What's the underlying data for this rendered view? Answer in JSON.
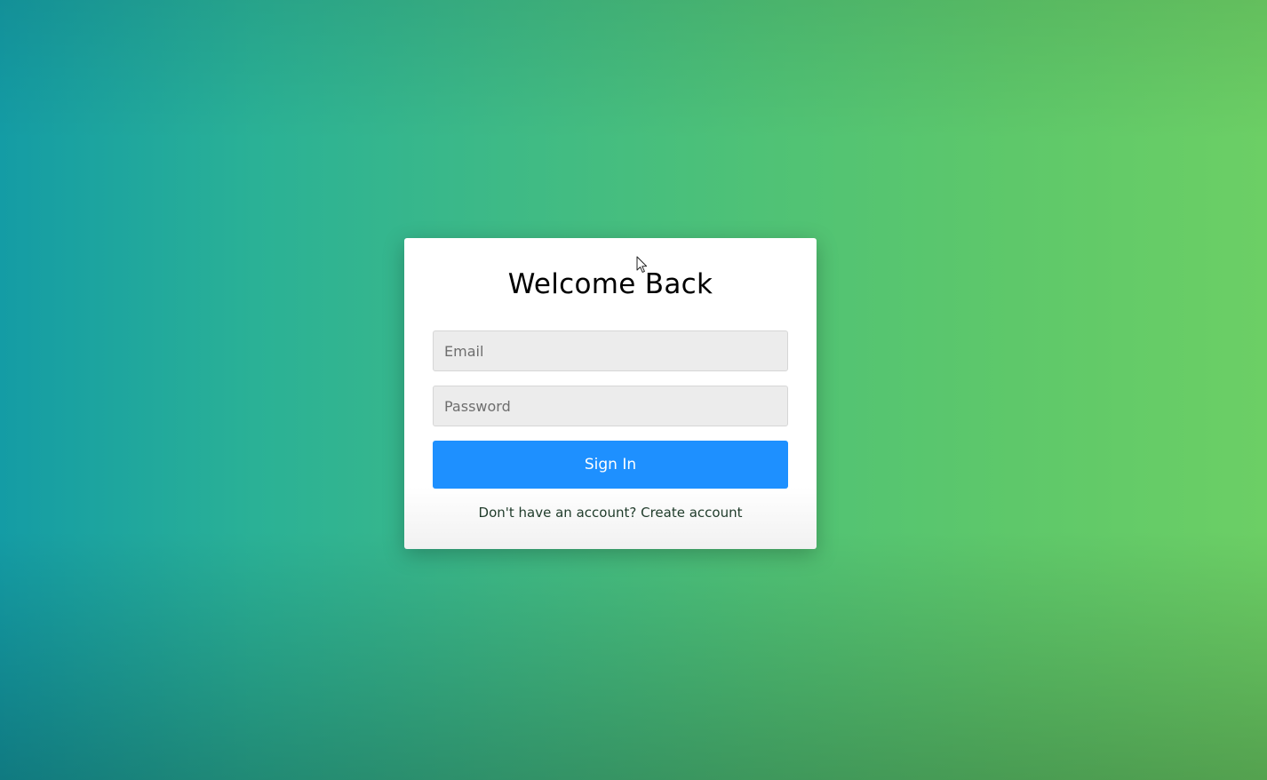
{
  "login": {
    "title": "Welcome Back",
    "email_placeholder": "Email",
    "email_value": "",
    "password_placeholder": "Password",
    "password_value": "",
    "sign_in_label": "Sign In",
    "footer_prompt": "Don't have an account?",
    "create_account_label": "Create account"
  },
  "colors": {
    "background_gradient_left": "#149ca5",
    "background_gradient_right": "#6ccf65",
    "card_background": "#ffffff",
    "input_background": "#ececec",
    "primary_button": "#1e90ff",
    "footer_text": "#1f3b2a"
  },
  "icons": {
    "cursor": "mouse-pointer-icon"
  }
}
